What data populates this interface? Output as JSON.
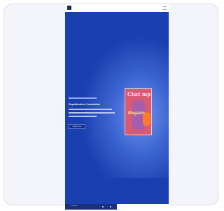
{
  "hero": {
    "kicker": "",
    "headline": "Republication / translation",
    "cta_label": "Read more"
  },
  "magazine": {
    "title": "Chat mp",
    "subtitle": "Magazin"
  },
  "footer": {
    "label": "Contact"
  },
  "colors": {
    "background": "#1a3fb0",
    "accent_pink": "#d85a75",
    "card": "#f4f5fb"
  }
}
